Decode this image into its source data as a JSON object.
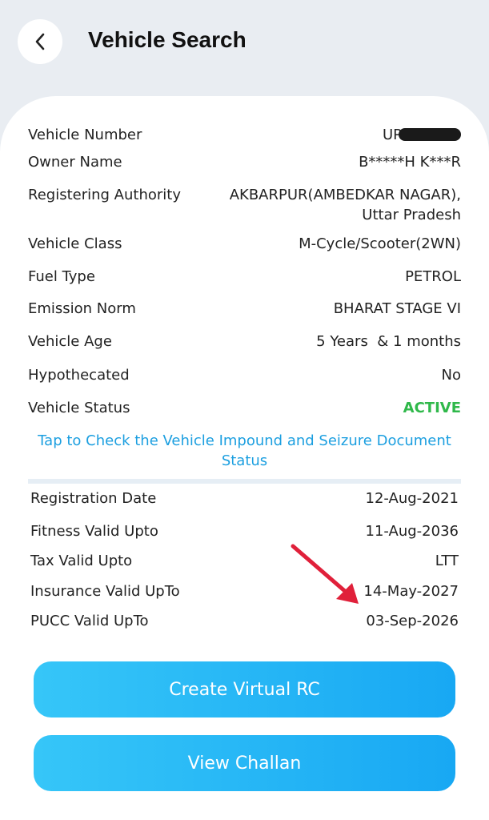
{
  "header": {
    "title": "Vehicle Search"
  },
  "icons": {
    "back": "chevron-left-icon",
    "arrow": "red-arrow-icon"
  },
  "colors": {
    "accent": "#1c9fe0",
    "active": "#2fb84a",
    "button": "#18a8f3",
    "arrow": "#e0203a"
  },
  "details": [
    {
      "label": "Vehicle Number",
      "value": "UP"
    },
    {
      "label": "Owner Name",
      "value": "B*****H K***R"
    },
    {
      "label": "Registering Authority",
      "value": "AKBARPUR(AMBEDKAR NAGAR),",
      "value2": "Uttar Pradesh"
    },
    {
      "label": "Vehicle Class",
      "value": "M-Cycle/Scooter(2WN)"
    },
    {
      "label": "Fuel Type",
      "value": "PETROL"
    },
    {
      "label": "Emission Norm",
      "value": "BHARAT STAGE VI"
    },
    {
      "label": "Vehicle Age",
      "value": "5 Years  & 1 months"
    },
    {
      "label": "Hypothecated",
      "value": "No"
    },
    {
      "label": "Vehicle Status",
      "value": "ACTIVE"
    }
  ],
  "impound_link": "Tap to Check the Vehicle Impound and Seizure Document Status",
  "validity": [
    {
      "label": "Registration Date",
      "value": "12-Aug-2021"
    },
    {
      "label": "Fitness Valid Upto",
      "value": "11-Aug-2036"
    },
    {
      "label": "Tax Valid Upto",
      "value": "LTT"
    },
    {
      "label": "Insurance Valid UpTo",
      "value": "14-May-2027"
    },
    {
      "label": "PUCC Valid UpTo",
      "value": "03-Sep-2026"
    }
  ],
  "buttons": {
    "create_rc": "Create Virtual RC",
    "view_challan": "View Challan"
  }
}
